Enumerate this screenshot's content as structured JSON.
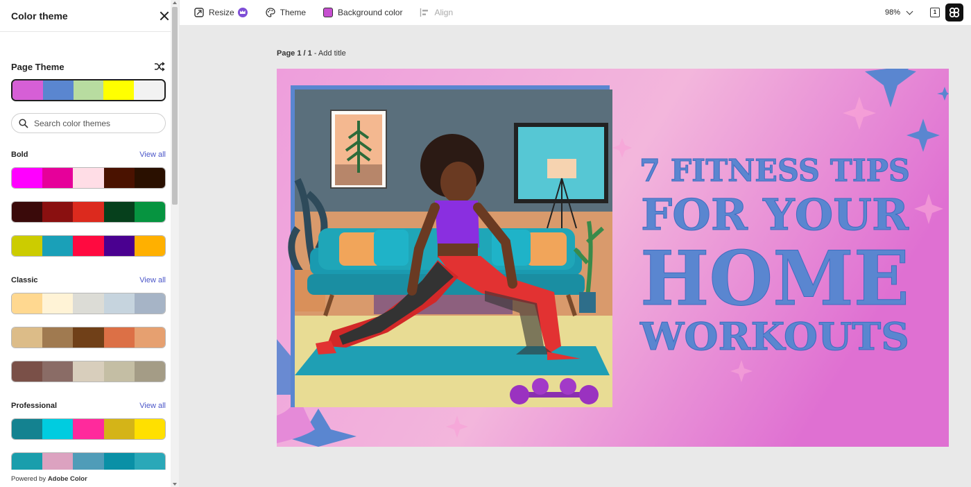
{
  "panel": {
    "title": "Color theme",
    "page_theme_label": "Page Theme",
    "current_theme": [
      "#d65fd6",
      "#5a86d0",
      "#b8dca0",
      "#ffff00",
      "#f2f2f2"
    ],
    "search_placeholder": "Search color themes",
    "sections": [
      {
        "title": "Bold",
        "view_all": "View all",
        "themes": [
          [
            "#ff00ff",
            "#e6009a",
            "#ffdde6",
            "#4a1200",
            "#2a1000"
          ],
          [
            "#3a0a0a",
            "#8a1010",
            "#dc2a1e",
            "#06401c",
            "#069440"
          ],
          [
            "#cccc00",
            "#1aa0b8",
            "#ff0a40",
            "#4a0090",
            "#ffb000"
          ]
        ]
      },
      {
        "title": "Classic",
        "view_all": "View all",
        "themes": [
          [
            "#ffd890",
            "#fff3d6",
            "#dcdcd6",
            "#c6d4de",
            "#a6b4c6"
          ],
          [
            "#dcbc88",
            "#a07a50",
            "#704018",
            "#dc7046",
            "#e6a070"
          ],
          [
            "#7a5048",
            "#8a6c66",
            "#d8cebc",
            "#c4bea4",
            "#a49c86"
          ]
        ]
      },
      {
        "title": "Professional",
        "view_all": "View all",
        "themes": [
          [
            "#148290",
            "#00cce0",
            "#ff2a9c",
            "#d4b418",
            "#ffe000"
          ],
          [
            "#1a9eac",
            "#dca2c0",
            "#509cb8",
            "#0a90a6",
            "#2aa8b8"
          ]
        ]
      }
    ],
    "powered_prefix": "Powered by ",
    "powered_brand": "Adobe Color"
  },
  "toolbar": {
    "resize": "Resize",
    "theme": "Theme",
    "background_color": "Background color",
    "align": "Align",
    "zoom": "98%",
    "page_count_icon": "1"
  },
  "canvas": {
    "page_label_bold": "Page 1 / 1",
    "page_label_rest": " - Add title",
    "headline": {
      "line1": "7 FITNESS TIPS",
      "line2": "FOR YOUR",
      "line3": "HOME",
      "line4": "WORKOUTS"
    },
    "colors": {
      "headline": "#5a86d0",
      "bg_pink": "#f3b6dc",
      "bg_magenta": "#e06cd0"
    }
  }
}
